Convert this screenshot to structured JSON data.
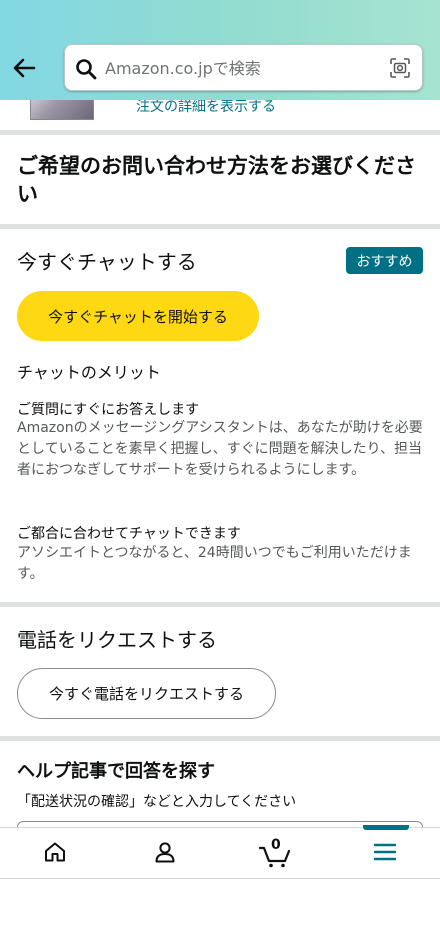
{
  "header": {
    "back_icon": "arrow-left-icon",
    "search_placeholder": "Amazon.co.jpで検索",
    "search_icon": "search-icon",
    "camera_icon": "camera-scan-icon",
    "gradient_colors": [
      "#82d8e3",
      "#a6e4d1"
    ]
  },
  "order": {
    "link_text": "注文の詳細を表示する"
  },
  "contact_method": {
    "title": "ご希望のお問い合わせ方法をお選びください"
  },
  "chat": {
    "heading": "今すぐチャットする",
    "badge": "おすすめ",
    "button_label": "今すぐチャットを開始する",
    "merits_title": "チャットのメリット",
    "benefits": [
      {
        "title": "ご質問にすぐにお答えします",
        "desc": "Amazonのメッセージングアシスタントは、あなたが助けを必要としていることを素早く把握し、すぐに問題を解決したり、担当者におつなぎしてサポートを受けられるようにします。"
      },
      {
        "title": "ご都合に合わせてチャットできます",
        "desc": "アソシエイトとつながると、24時間いつでもご利用いただけます。"
      }
    ]
  },
  "phone": {
    "heading": "電話をリクエストする",
    "button_label": "今すぐ電話をリクエストする"
  },
  "help": {
    "heading": "ヘルプ記事で回答を探す",
    "hint": "「配送状況の確認」などと入力してください"
  },
  "bottom_nav": {
    "items": [
      {
        "icon": "home-icon"
      },
      {
        "icon": "account-icon"
      },
      {
        "icon": "cart-icon",
        "count": "0"
      },
      {
        "icon": "menu-icon",
        "active": true
      }
    ]
  },
  "colors": {
    "accent": "#007185",
    "button_yellow": "#ffd814",
    "text": "#0f1111",
    "muted_text": "#565959"
  }
}
